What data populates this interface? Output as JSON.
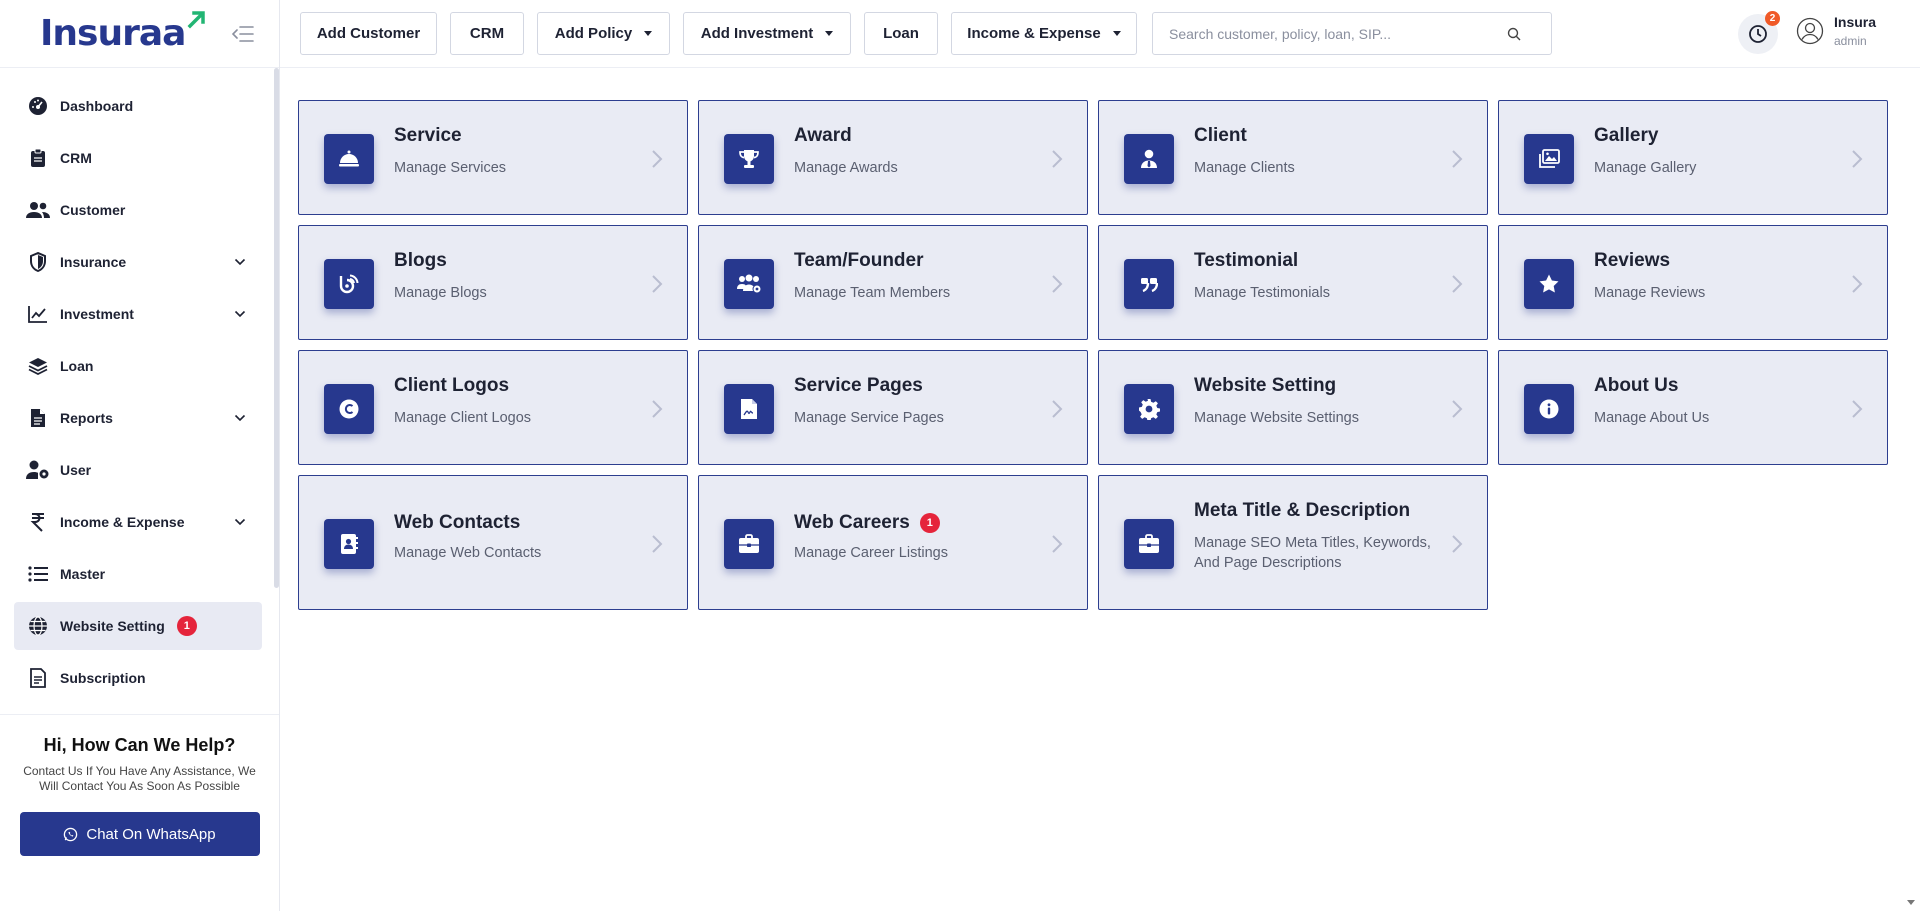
{
  "brand": {
    "name": "Insuraa",
    "accent": "#27388e",
    "mark_color": "#22b573"
  },
  "sidebar": {
    "items": [
      {
        "label": "Dashboard",
        "icon": "dashboard-icon",
        "chevron": false
      },
      {
        "label": "CRM",
        "icon": "clipboard-icon",
        "chevron": false
      },
      {
        "label": "Customer",
        "icon": "users-icon",
        "chevron": false
      },
      {
        "label": "Insurance",
        "icon": "shield-icon",
        "chevron": true
      },
      {
        "label": "Investment",
        "icon": "chart-line-icon",
        "chevron": true
      },
      {
        "label": "Loan",
        "icon": "layers-icon",
        "chevron": false
      },
      {
        "label": "Reports",
        "icon": "file-icon",
        "chevron": true
      },
      {
        "label": "User",
        "icon": "user-gear-icon",
        "chevron": false
      },
      {
        "label": "Income & Expense",
        "icon": "rupee-icon",
        "chevron": true
      },
      {
        "label": "Master",
        "icon": "list-icon",
        "chevron": false
      },
      {
        "label": "Website Setting",
        "icon": "globe-icon",
        "badge": "1",
        "active": true
      },
      {
        "label": "Subscription",
        "icon": "document-icon",
        "chevron": false
      }
    ],
    "help": {
      "title": "Hi, How Can We Help?",
      "text": "Contact Us If You Have Any Assistance, We Will Contact You As Soon As Possible",
      "button": "Chat On WhatsApp"
    }
  },
  "header": {
    "buttons": [
      {
        "label": "Add Customer",
        "dropdown": false
      },
      {
        "label": "CRM",
        "dropdown": false
      },
      {
        "label": "Add Policy",
        "dropdown": true
      },
      {
        "label": "Add Investment",
        "dropdown": true
      },
      {
        "label": "Loan",
        "dropdown": false
      },
      {
        "label": "Income & Expense",
        "dropdown": true
      }
    ],
    "search_placeholder": "Search customer, policy, loan, SIP...",
    "notification_count": "2",
    "user": {
      "name": "Insura",
      "role": "admin"
    }
  },
  "cards": [
    {
      "title": "Service",
      "subtitle": "Manage Services",
      "icon": "bell-icon"
    },
    {
      "title": "Award",
      "subtitle": "Manage Awards",
      "icon": "trophy-icon"
    },
    {
      "title": "Client",
      "subtitle": "Manage Clients",
      "icon": "user-tie-icon"
    },
    {
      "title": "Gallery",
      "subtitle": "Manage Gallery",
      "icon": "images-icon"
    },
    {
      "title": "Blogs",
      "subtitle": "Manage Blogs",
      "icon": "blog-icon"
    },
    {
      "title": "Team/Founder",
      "subtitle": "Manage Team Members",
      "icon": "team-icon"
    },
    {
      "title": "Testimonial",
      "subtitle": "Manage Testimonials",
      "icon": "quote-icon"
    },
    {
      "title": "Reviews",
      "subtitle": "Manage Reviews",
      "icon": "star-icon"
    },
    {
      "title": "Client Logos",
      "subtitle": "Manage Client Logos",
      "icon": "copyright-icon"
    },
    {
      "title": "Service Pages",
      "subtitle": "Manage Service Pages",
      "icon": "file-signature-icon"
    },
    {
      "title": "Website Setting",
      "subtitle": "Manage Website Settings",
      "icon": "gear-icon"
    },
    {
      "title": "About Us",
      "subtitle": "Manage About Us",
      "icon": "info-icon"
    },
    {
      "title": "Web Contacts",
      "subtitle": "Manage Web Contacts",
      "icon": "address-book-icon"
    },
    {
      "title": "Web Careers",
      "subtitle": "Manage Career Listings",
      "icon": "briefcase-icon",
      "badge": "1"
    },
    {
      "title": "Meta Title & Description",
      "subtitle": "Manage SEO Meta Titles, Keywords, And Page Descriptions",
      "icon": "briefcase-icon"
    }
  ]
}
